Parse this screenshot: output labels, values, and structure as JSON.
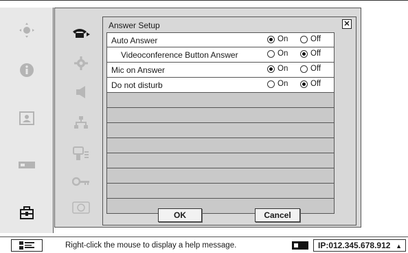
{
  "dialog": {
    "title": "Answer Setup",
    "close_glyph": "✕",
    "on_label": "On",
    "off_label": "Off",
    "rows": [
      {
        "label": "Auto Answer",
        "value": "On",
        "indent": false
      },
      {
        "label": "Videoconference Button Answer",
        "value": "Off",
        "indent": true
      },
      {
        "label": "Mic on Answer",
        "value": "On",
        "indent": false
      },
      {
        "label": "Do not disturb",
        "value": "Off",
        "indent": false
      }
    ],
    "empty_rows": 8,
    "ok_label": "OK",
    "cancel_label": "Cancel"
  },
  "left_nav": {
    "items": [
      {
        "icon": "camera-control-icon",
        "active": false
      },
      {
        "icon": "info-icon",
        "active": false
      },
      {
        "icon": "picture-icon",
        "active": false
      },
      {
        "icon": "monitor-input-icon",
        "active": false
      },
      {
        "icon": "toolbox-icon",
        "active": true
      }
    ]
  },
  "sub_nav": {
    "items": [
      {
        "icon": "telephone-icon",
        "active": true
      },
      {
        "icon": "gear-icon",
        "active": false
      },
      {
        "icon": "speaker-icon",
        "active": false
      },
      {
        "icon": "network-icon",
        "active": false
      },
      {
        "icon": "video-audio-icon",
        "active": false
      },
      {
        "icon": "key-icon",
        "active": false
      },
      {
        "icon": "device-icon",
        "active": false
      }
    ]
  },
  "status_bar": {
    "message": "Right-click the mouse to display a help message.",
    "ip": "IP:012.345.678.912",
    "arrow": "▲"
  }
}
